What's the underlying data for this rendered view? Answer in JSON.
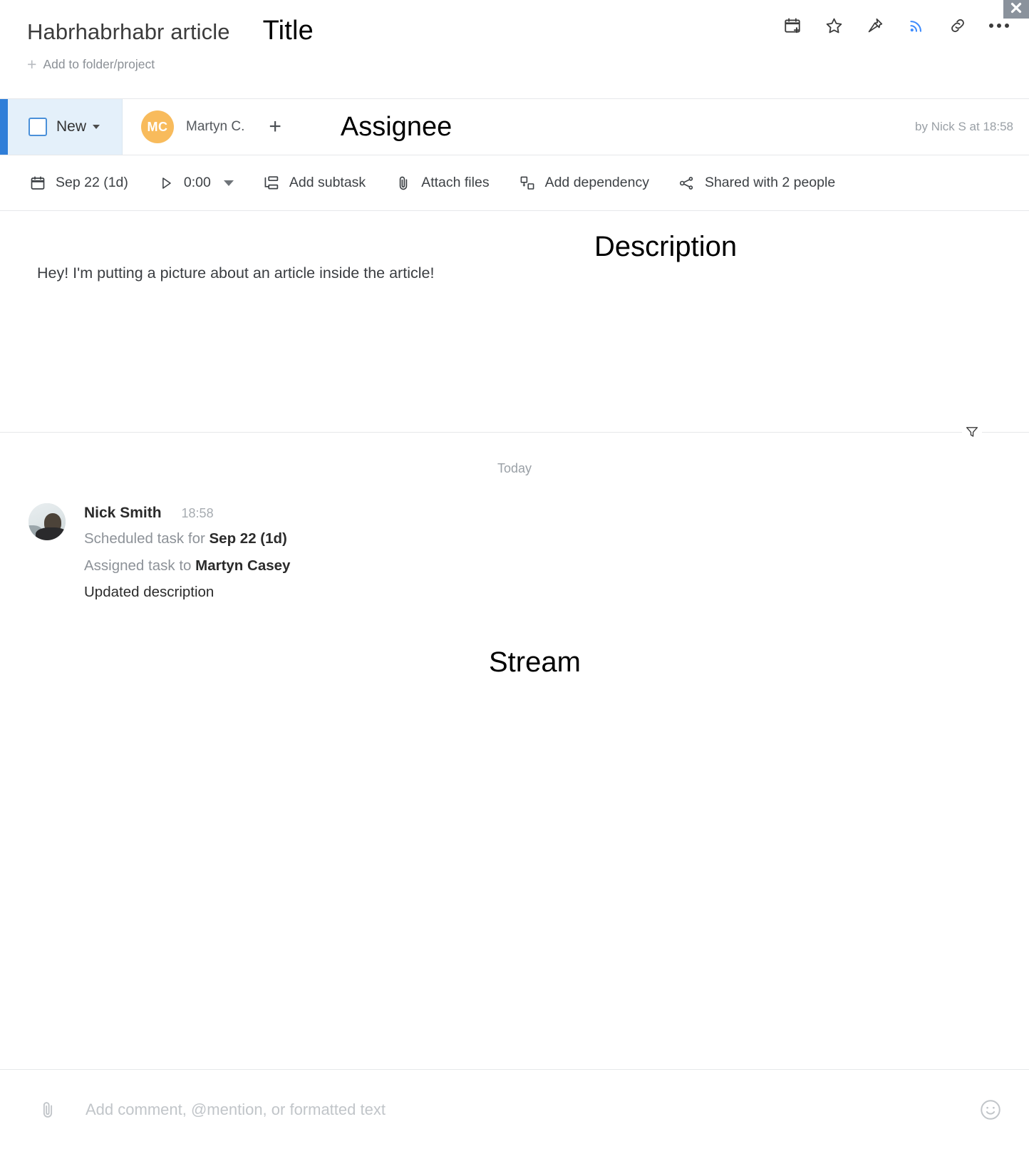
{
  "window": {
    "close_label": "×"
  },
  "header": {
    "title": "Habrhabrhabr article",
    "add_folder_label": "Add to folder/project",
    "plus_glyph": "+",
    "icons": [
      {
        "name": "calendar-plus-icon",
        "tooltip": "Add to calendar"
      },
      {
        "name": "star-icon",
        "tooltip": "Favorite"
      },
      {
        "name": "pin-icon",
        "tooltip": "Pin"
      },
      {
        "name": "follow-rss-icon",
        "tooltip": "Follow",
        "color": "#3d8bfd"
      },
      {
        "name": "link-icon",
        "tooltip": "Copy link"
      },
      {
        "name": "more-icon",
        "tooltip": "More"
      }
    ]
  },
  "annotations": {
    "title": "Title",
    "assignee": "Assignee",
    "description": "Description",
    "stream": "Stream"
  },
  "status_bar": {
    "accent_color": "#2f7ed8",
    "chip_background": "#e4f0fa",
    "status_label": "New",
    "assignee": {
      "initials": "MC",
      "name": "Martyn C.",
      "avatar_color": "#f8bb5c"
    },
    "add_assignee_glyph": "+",
    "meta": "by Nick S at 18:58"
  },
  "toolbar": {
    "items": [
      {
        "icon": "calendar-icon",
        "label": "Sep 22 (1d)"
      },
      {
        "icon": "play-icon",
        "label": "0:00",
        "has_chevron": true
      },
      {
        "icon": "subtask-icon",
        "label": "Add subtask"
      },
      {
        "icon": "paperclip-icon",
        "label": "Attach files"
      },
      {
        "icon": "dependency-icon",
        "label": "Add dependency"
      },
      {
        "icon": "share-icon",
        "label": "Shared with 2 people"
      }
    ]
  },
  "description": {
    "text": "Hey! I'm putting a picture about an article inside the article!"
  },
  "stream": {
    "filter_icon": "filter-icon",
    "day_separator": "Today",
    "entries": [
      {
        "author": "Nick Smith",
        "time": "18:58",
        "lines": [
          {
            "prefix": "Scheduled task for ",
            "strong": "Sep 22 (1d)"
          },
          {
            "prefix": "Assigned task to ",
            "strong": "Martyn Casey"
          },
          {
            "plain": "Updated description"
          }
        ]
      }
    ]
  },
  "comment_bar": {
    "attach_icon": "paperclip-icon",
    "placeholder": "Add comment, @mention, or formatted text",
    "value": "",
    "emoji_icon": "smiley-icon"
  }
}
